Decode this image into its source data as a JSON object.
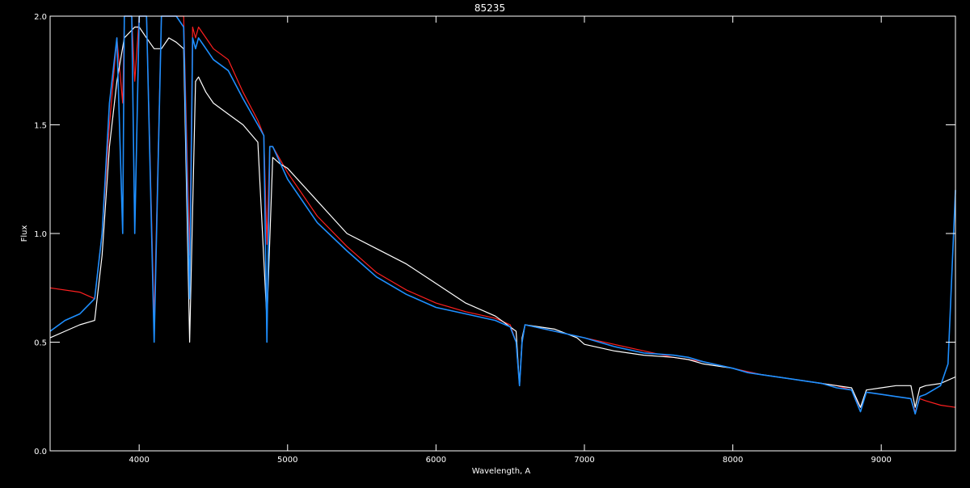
{
  "chart_data": {
    "type": "line",
    "title": "85235",
    "xlabel": "Wavelength, A",
    "ylabel": "Flux",
    "xlim": [
      3400,
      9500
    ],
    "ylim": [
      0.0,
      2.0
    ],
    "x_ticks": [
      4000,
      5000,
      6000,
      7000,
      8000,
      9000
    ],
    "y_ticks": [
      0.0,
      0.5,
      1.0,
      1.5,
      2.0
    ],
    "x_tick_labels": [
      "4000",
      "5000",
      "6000",
      "7000",
      "8000",
      "9000"
    ],
    "y_tick_labels": [
      "0.0",
      "0.5",
      "1.0",
      "1.5",
      "2.0"
    ],
    "grid": false,
    "background": "#000000",
    "series": [
      {
        "color": "#ff2020",
        "x": [
          3400,
          3600,
          3700,
          3750,
          3800,
          3850,
          3889,
          3900,
          3950,
          3970,
          4000,
          4050,
          4101,
          4150,
          4200,
          4300,
          4340,
          4360,
          4380,
          4400,
          4450,
          4500,
          4600,
          4700,
          4800,
          4840,
          4861,
          4880,
          4900,
          5000,
          5200,
          5400,
          5600,
          5800,
          6000,
          6200,
          6400,
          6500,
          6540,
          6563,
          6580,
          6600,
          6800,
          7000,
          7200,
          7400,
          7600,
          7800,
          8000,
          8200,
          8400,
          8500,
          8600,
          8700,
          8800,
          8860,
          8900,
          9000,
          9100,
          9200,
          9229,
          9260,
          9300,
          9400,
          9500
        ],
        "y": [
          0.75,
          0.73,
          0.7,
          1.0,
          1.5,
          1.9,
          1.6,
          2.05,
          2.1,
          1.7,
          2.1,
          2.1,
          0.6,
          2.05,
          2.05,
          2.0,
          0.9,
          1.95,
          1.9,
          1.95,
          1.9,
          1.85,
          1.8,
          1.65,
          1.52,
          1.45,
          0.95,
          1.4,
          1.4,
          1.28,
          1.08,
          0.94,
          0.82,
          0.74,
          0.68,
          0.64,
          0.61,
          0.58,
          0.5,
          0.3,
          0.5,
          0.58,
          0.55,
          0.52,
          0.49,
          0.46,
          0.43,
          0.41,
          0.38,
          0.35,
          0.33,
          0.32,
          0.31,
          0.3,
          0.28,
          0.2,
          0.27,
          0.26,
          0.25,
          0.24,
          0.18,
          0.24,
          0.23,
          0.21,
          0.2
        ]
      },
      {
        "color": "#ffffff",
        "x": [
          3400,
          3500,
          3600,
          3700,
          3750,
          3800,
          3850,
          3900,
          3970,
          4000,
          4050,
          4101,
          4150,
          4200,
          4250,
          4300,
          4340,
          4380,
          4400,
          4450,
          4500,
          4600,
          4700,
          4800,
          4861,
          4900,
          4950,
          5000,
          5200,
          5400,
          5600,
          5800,
          6000,
          6200,
          6400,
          6540,
          6563,
          6580,
          6600,
          6800,
          6950,
          7000,
          7200,
          7400,
          7600,
          7700,
          7800,
          8000,
          8100,
          8300,
          8400,
          8600,
          8700,
          8800,
          8860,
          8900,
          9000,
          9100,
          9200,
          9229,
          9260,
          9300,
          9400,
          9500
        ],
        "y": [
          0.52,
          0.55,
          0.58,
          0.6,
          0.9,
          1.4,
          1.7,
          1.9,
          1.95,
          1.95,
          1.9,
          1.85,
          1.85,
          1.9,
          1.88,
          1.85,
          0.5,
          1.7,
          1.72,
          1.65,
          1.6,
          1.55,
          1.5,
          1.42,
          0.6,
          1.35,
          1.32,
          1.3,
          1.15,
          1.0,
          0.93,
          0.86,
          0.77,
          0.68,
          0.62,
          0.55,
          0.3,
          0.52,
          0.58,
          0.56,
          0.52,
          0.49,
          0.46,
          0.44,
          0.43,
          0.42,
          0.4,
          0.38,
          0.36,
          0.34,
          0.33,
          0.31,
          0.3,
          0.29,
          0.2,
          0.28,
          0.29,
          0.3,
          0.3,
          0.2,
          0.29,
          0.3,
          0.31,
          0.34
        ]
      },
      {
        "color": "#1e8fff",
        "x": [
          3400,
          3500,
          3600,
          3700,
          3750,
          3800,
          3850,
          3889,
          3900,
          3950,
          3970,
          4000,
          4050,
          4101,
          4150,
          4200,
          4250,
          4300,
          4340,
          4360,
          4380,
          4400,
          4450,
          4500,
          4600,
          4700,
          4800,
          4840,
          4861,
          4880,
          4900,
          5000,
          5200,
          5400,
          5600,
          5800,
          6000,
          6200,
          6400,
          6500,
          6540,
          6563,
          6580,
          6600,
          6800,
          7000,
          7200,
          7400,
          7600,
          7700,
          7800,
          8000,
          8100,
          8200,
          8400,
          8500,
          8600,
          8700,
          8800,
          8860,
          8900,
          9000,
          9100,
          9200,
          9229,
          9260,
          9300,
          9400,
          9450,
          9500
        ],
        "y": [
          0.55,
          0.6,
          0.63,
          0.7,
          1.0,
          1.6,
          1.9,
          1.0,
          2.05,
          2.1,
          1.0,
          2.1,
          2.1,
          0.5,
          2.05,
          2.05,
          2.0,
          1.95,
          0.7,
          1.9,
          1.85,
          1.9,
          1.85,
          1.8,
          1.75,
          1.62,
          1.5,
          1.45,
          0.5,
          1.4,
          1.4,
          1.25,
          1.05,
          0.92,
          0.8,
          0.72,
          0.66,
          0.63,
          0.6,
          0.57,
          0.5,
          0.3,
          0.5,
          0.58,
          0.55,
          0.52,
          0.48,
          0.45,
          0.44,
          0.43,
          0.41,
          0.38,
          0.36,
          0.35,
          0.33,
          0.32,
          0.31,
          0.29,
          0.28,
          0.18,
          0.27,
          0.26,
          0.25,
          0.24,
          0.17,
          0.25,
          0.26,
          0.3,
          0.4,
          1.2
        ]
      }
    ]
  }
}
